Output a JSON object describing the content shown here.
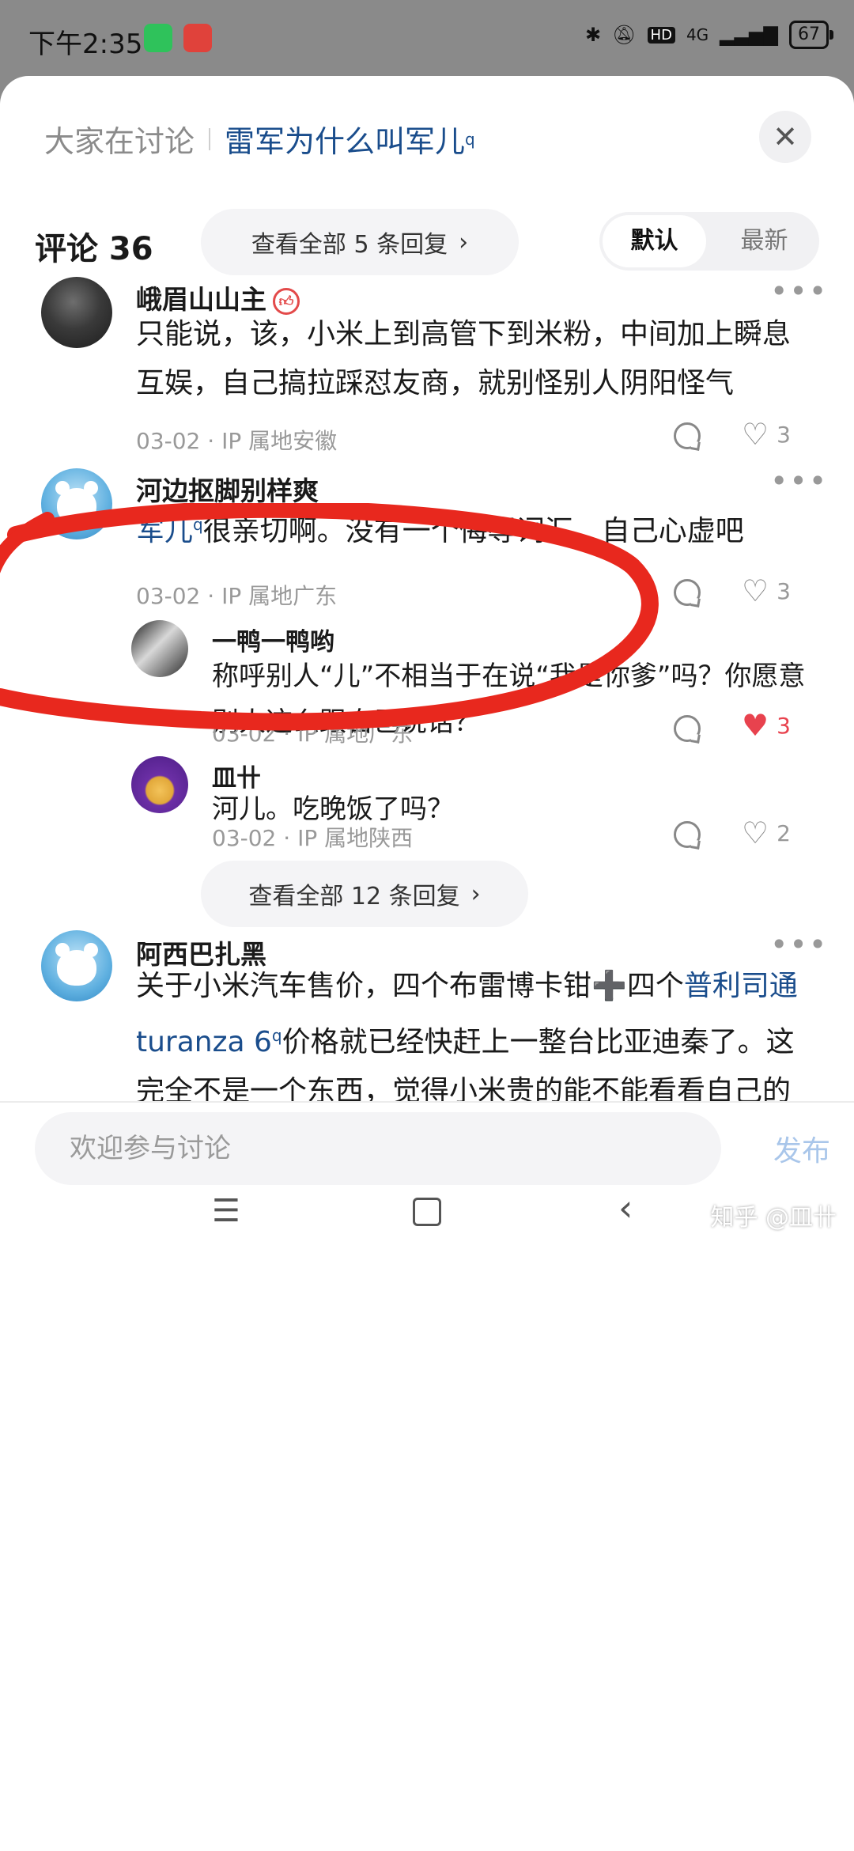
{
  "status_bar": {
    "time": "下午2:35",
    "network": "4G",
    "hd": "HD",
    "battery": "67"
  },
  "header": {
    "topic_label": "大家在讨论",
    "topic_link": "雷军为什么叫军儿",
    "close": "✕"
  },
  "comments_header": {
    "title": "评论 36",
    "sort_default": "默认",
    "sort_latest": "最新"
  },
  "more_replies_top": "查看全部 5 条回复",
  "more_replies_mid": "查看全部 12 条回复",
  "comments": [
    {
      "name": "峨眉山山主",
      "text": "只能说，该，小米上到高管下到米粉，中间加上瞬息互娱，自己搞拉踩怼友商，就别怪别人阴阳怪气",
      "meta": "03-02 · IP 属地安徽",
      "likes": "3"
    },
    {
      "name": "河边抠脚别样爽",
      "link": "军儿",
      "text": "很亲切啊。没有一个侮辱词汇，自己心虚吧",
      "meta": "03-02 · IP 属地广东",
      "likes": "3"
    },
    {
      "name": "阿西巴扎黑",
      "text_a": "关于小米汽车售价，四个布雷博卡钳➕四个",
      "link": "普利司通turanza 6",
      "text_b": "价格就已经快赶上一整台比亚迪秦了。这完全不是一个东西，觉得小米贵的能不能看看自己的预算？或者自己的驾驶水平需"
    }
  ],
  "replies": [
    {
      "name": "一鸭一鸭哟",
      "text": "称呼别人“儿”不相当于在说“我是你爹”吗？你愿意别人这么跟自己说话？",
      "meta": "03-02 · IP 属地广东",
      "likes": "3",
      "liked": true
    },
    {
      "name": "皿卄",
      "text": "河儿。吃晚饭了吗？",
      "meta": "03-02 · IP 属地陕西",
      "likes": "2"
    }
  ],
  "composer": {
    "placeholder": "欢迎参与讨论",
    "post": "发布"
  },
  "watermark": "知乎 @皿卄",
  "colors": {
    "link": "#1a4d8c",
    "liked": "#e8424e",
    "annotation": "#e8281e",
    "post_disabled": "#a9c6ea"
  }
}
